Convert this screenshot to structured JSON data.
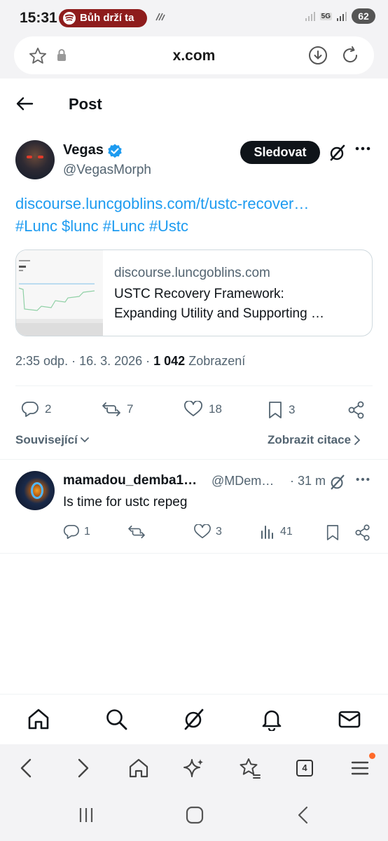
{
  "status_bar": {
    "time": "15:31",
    "media_pill": "Bůh drží ta",
    "network": "5G",
    "battery": "62"
  },
  "browser": {
    "url": "x.com",
    "tab_count": "4"
  },
  "header": {
    "title": "Post"
  },
  "post": {
    "author_name": "Vegas",
    "author_handle": "@VegasMorph",
    "follow_label": "Sledovat",
    "link_text": "discourse.luncgoblins.com/t/ustc-recover…",
    "hashtags": "#Lunc $lunc #Lunc #Ustc",
    "card": {
      "domain": "discourse.luncgoblins.com",
      "title_line1": "USTC Recovery Framework:",
      "title_line2": "Expanding Utility and Supporting …"
    },
    "timestamp": "2:35 odp. · 16. 3. 2026 · ",
    "views_count": "1 042",
    "views_label": "Zobrazení",
    "actions": {
      "replies": "2",
      "reposts": "7",
      "likes": "18",
      "bookmarks": "3"
    },
    "related_label": "Související",
    "quotes_label": "Zobrazit citace"
  },
  "reply": {
    "author_name": "mamadou_demba1…",
    "author_handle": "@MDem…",
    "time": "· 31 m",
    "text": "Is time for ustc repeg",
    "actions": {
      "replies": "1",
      "likes": "3",
      "views": "41"
    }
  },
  "colors": {
    "accent": "#1d9bf0",
    "text": "#0f1419",
    "muted": "#536471",
    "pill": "#8e1c1c"
  }
}
